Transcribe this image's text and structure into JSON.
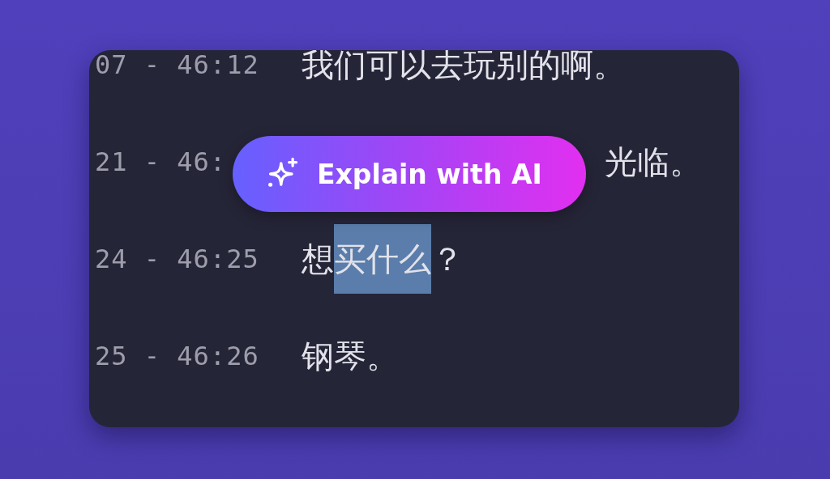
{
  "subtitles": [
    {
      "time": "07 - 46:12",
      "segments": [
        {
          "text": "我们可以去玩别的啊。",
          "selected": false
        }
      ]
    },
    {
      "time": "21 - 46:",
      "popup": {
        "label": "Explain with AI"
      },
      "segments": [
        {
          "text": "光临。",
          "selected": false
        }
      ]
    },
    {
      "time": "24 - 46:25",
      "segments": [
        {
          "text": "想",
          "selected": false
        },
        {
          "text": "买什么",
          "selected": true
        },
        {
          "text": "？",
          "selected": false
        }
      ]
    },
    {
      "time": "25 - 46:26",
      "segments": [
        {
          "text": "钢琴。",
          "selected": false
        }
      ]
    }
  ]
}
